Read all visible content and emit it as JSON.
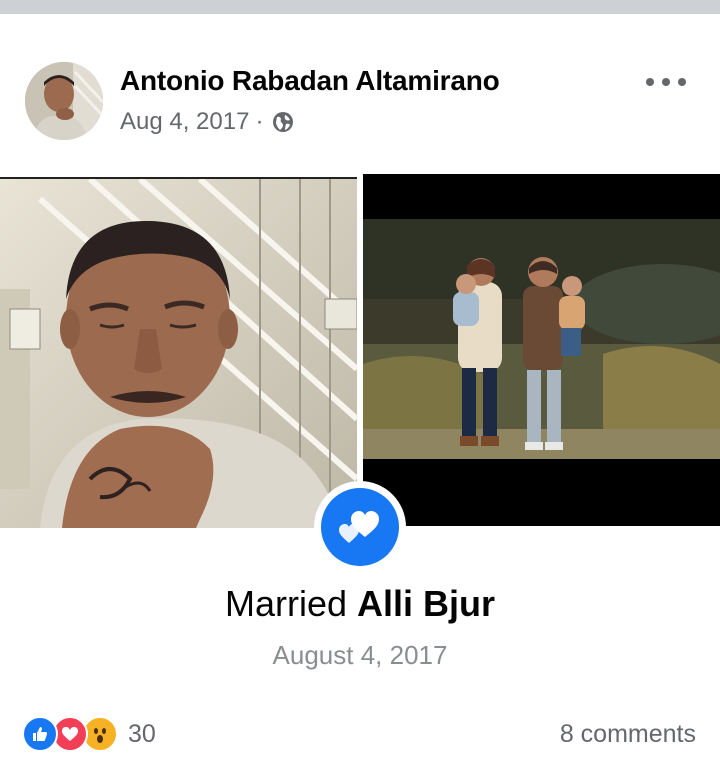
{
  "post": {
    "author": "Antonio Rabadan Altamirano",
    "date": "Aug 4, 2017",
    "separator": "·",
    "privacy_icon": "globe-icon",
    "more_icon": "more-options-icon"
  },
  "life_event": {
    "icon": "hearts-icon",
    "title_prefix": "Married",
    "partner": "Alli Bjur",
    "date": "August 4, 2017"
  },
  "footer": {
    "reaction_icons": [
      "like-icon",
      "love-icon",
      "wow-icon"
    ],
    "reaction_count": "30",
    "comments": "8 comments"
  },
  "colors": {
    "accent": "#1877f2",
    "love": "#f33e58",
    "wow": "#f7b125",
    "secondary_text": "#65676b"
  }
}
